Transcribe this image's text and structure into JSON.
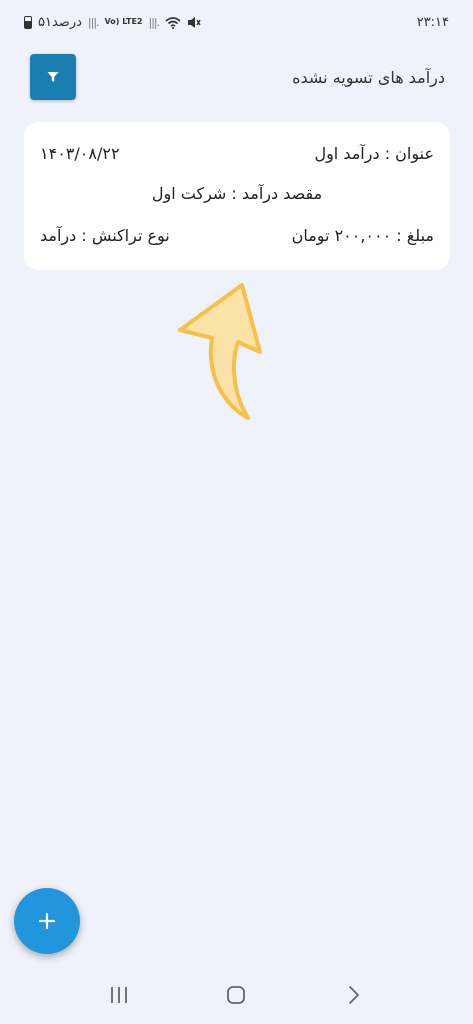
{
  "status_bar": {
    "battery_text": "۵۱درصد",
    "network_label": "Vo) LTE2",
    "time": "۲۳:۱۴"
  },
  "header": {
    "title": "درآمد های تسویه نشده",
    "filter_icon": "filter-icon"
  },
  "card": {
    "title": "عنوان : درآمد اول",
    "date": "۱۴۰۳/۰۸/۲۲",
    "destination": "مقصد درآمد : شرکت اول",
    "amount": "مبلغ : ۲۰۰,۰۰۰ تومان",
    "transaction_type": "نوع تراکنش : درآمد"
  },
  "colors": {
    "background": "#eff2fa",
    "card": "#ffffff",
    "filter_button": "#1a7fb0",
    "fab": "#2196dd",
    "arrow_fill": "#fbe3a8",
    "arrow_stroke": "#f6c04a"
  },
  "fab": {
    "icon": "plus-icon"
  },
  "nav": {
    "icons": [
      "recent-apps-icon",
      "home-icon",
      "back-icon"
    ]
  }
}
